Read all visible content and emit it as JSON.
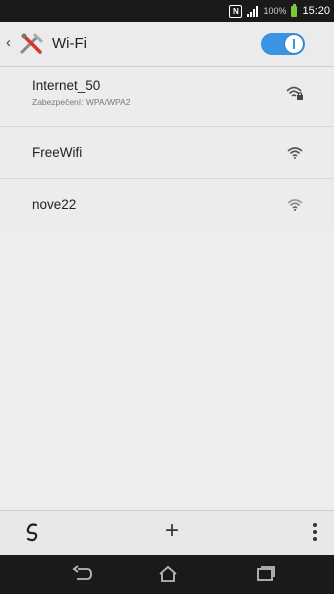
{
  "status_bar": {
    "battery_percent": "100%",
    "time": "15:20",
    "nfc_label": "N"
  },
  "action_bar": {
    "back": "‹",
    "title": "Wi-Fi",
    "wifi_toggle_on": true
  },
  "networks": [
    {
      "ssid": "Internet_50",
      "security": "Zabezpečení: WPA/WPA2",
      "icon": "wifi-locked-icon"
    },
    {
      "ssid": "FreeWifi",
      "security": "",
      "icon": "wifi-icon"
    },
    {
      "ssid": "nove22",
      "security": "",
      "icon": "wifi-weak-icon"
    }
  ],
  "toolbar": {
    "add_label": "+"
  },
  "colors": {
    "accent": "#3a94e4",
    "status_bar": "#1a1a1a",
    "battery": "#7ec63a"
  }
}
